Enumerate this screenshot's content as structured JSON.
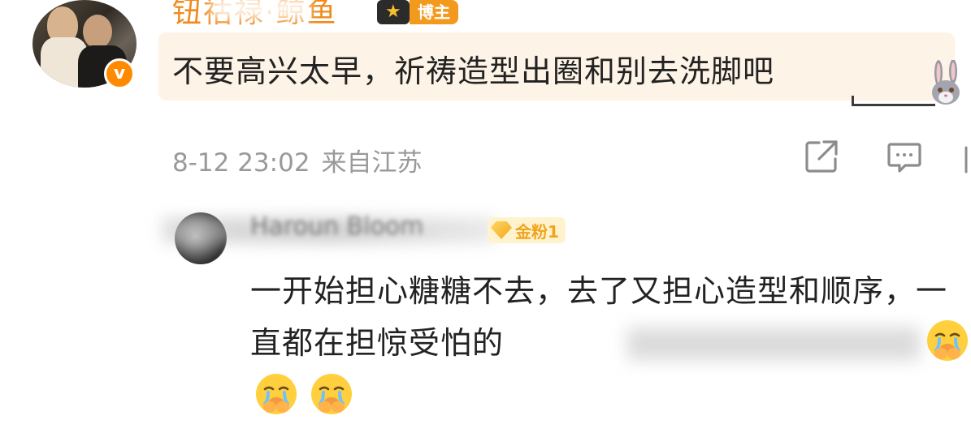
{
  "main_comment": {
    "username": "钮祜禄·鲸鱼",
    "blogger_badge": "博主",
    "verified_icon": "v-badge-icon",
    "text": "不要高兴太早，祈祷造型出圈和别去洗脚吧",
    "timestamp": "8-12 23:02",
    "location": "来自江苏",
    "actions": [
      "share-icon",
      "comment-icon"
    ]
  },
  "reply": {
    "username": "Haroun Bloom",
    "fan_badge": "金粉1",
    "text": "一开始担心糖糖不去，去了又担心造型和顺序，一直都在担惊受怕的",
    "emojis": [
      "crying-emoji",
      "crying-emoji",
      "crying-emoji"
    ]
  },
  "colors": {
    "username_orange": "#f08a1c",
    "bubble_bg": "#fdf3e6",
    "meta_gray": "#999999",
    "fan_gold": "#f0a41c"
  }
}
